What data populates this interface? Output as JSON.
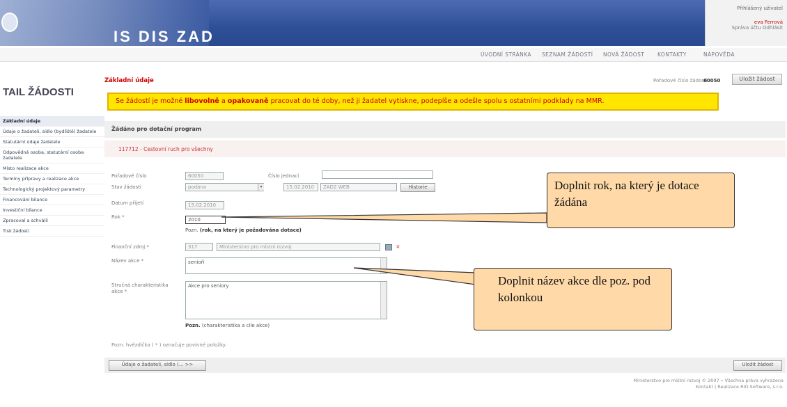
{
  "header": {
    "app_title": "IS DIS ZAD",
    "user_logged_label": "Přihlášený uživatel",
    "user_name": "eva Ferrová",
    "account_links": "Správa účtu Odhlásit"
  },
  "nav": {
    "items": [
      "ÚVODNÍ STRÁNKA",
      "SEZNAM ŽÁDOSTÍ",
      "NOVÁ ŽÁDOST",
      "KONTAKTY",
      "NÁPOVĚDA"
    ]
  },
  "sidebar": {
    "title": "TAIL ŽÁDOSTI",
    "items": [
      "Základní údaje",
      "Údaje o žadateli, sídlo (bydliště) žadatele",
      "Statutární údaje žadatele",
      "Odpovědná osoba, statutární osoba žadatele",
      "Místo realizace akce",
      "Termíny přípravy a realizace akce",
      "Technologický projektový parametry",
      "Financování bilance",
      "Investiční bilance",
      "Zpracoval a schválil",
      "Tisk žádosti"
    ]
  },
  "main": {
    "section_title": "Základní údaje",
    "request_no_label": "Pořadové číslo žádosti:",
    "request_no": "60050",
    "save_button": "Uložit žádost",
    "notice_pre": "Se žádostí je možné ",
    "notice_b1": "libovolně",
    "notice_mid": " a ",
    "notice_b2": "opakovaně",
    "notice_post": " pracovat do té doby, než ji žadatel vytiskne, podepíše a odešle spolu s ostatními podklady na MMR.",
    "program_header": "Žádáno pro dotační program",
    "program_value": "117712 - Cestovní ruch pro všechny"
  },
  "form": {
    "order_no_label": "Pořadové číslo",
    "order_no_value": "60050",
    "jednaci_label": "Číslo jednací",
    "jednaci_value": "",
    "state_label": "Stav žádosti",
    "state_value": "podána",
    "state_date": "15.02.2010",
    "state_source": "ZAD2 WEB",
    "history_button": "Historie",
    "received_label": "Datum přijetí",
    "received_value": "15.02.2010",
    "year_label": "Rok *",
    "year_value": "2010",
    "year_hint_prefix": "Pozn.",
    "year_hint": "(rok, na který je požadována dotace)",
    "admin_label": "Finanční zdroj *",
    "admin_code": "317",
    "admin_name": "Ministerstvo pro místní rozvoj",
    "action_name_label": "Název akce *",
    "action_name_value": "senioři",
    "desc_label": "Stručná charakteristika akce *",
    "desc_value": "Akce pro seniory",
    "desc_hint_prefix": "Pozn.",
    "desc_hint": "(charakteristika a cíle akce)",
    "required_note": "Pozn. hvězdička ( * ) označuje povinné položky."
  },
  "footer": {
    "back_button": "Údaje o žadateli, sídlo (... >>",
    "save_button": "Uložit žádost",
    "copyright_1": "Ministerstvo pro místní rozvoj © 2007 • Všechna práva vyhrazena",
    "copyright_2": "Kontakt | Realizace RIO Software, s.r.o."
  },
  "callouts": {
    "year": "Doplnit rok, na který je dotace žádána",
    "name": "Doplnit název akce dle poz. pod kolonkou"
  }
}
